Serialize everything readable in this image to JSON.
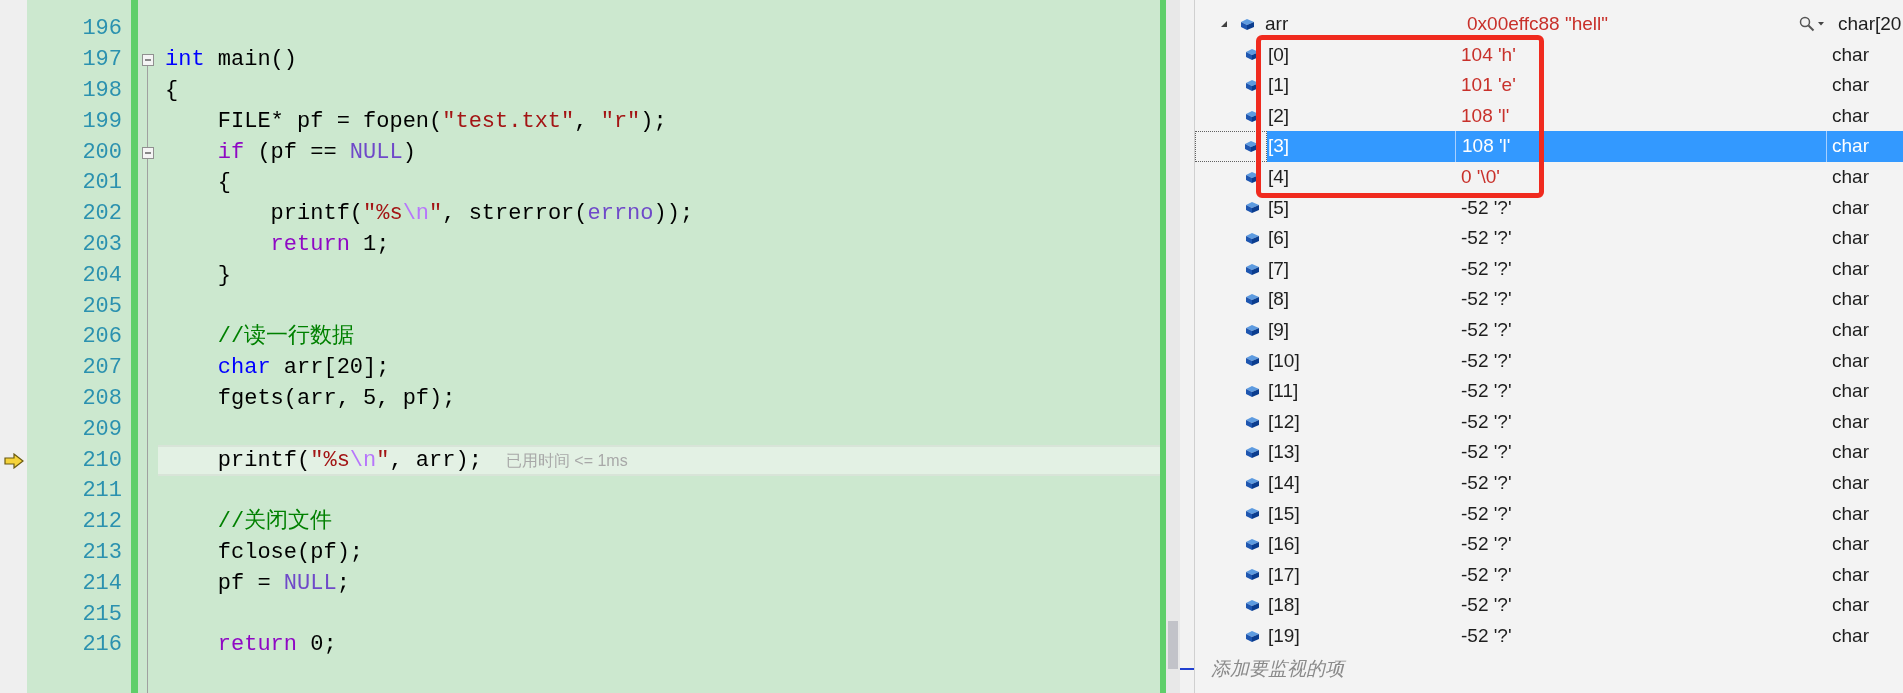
{
  "editor": {
    "lines": [
      {
        "number": "196",
        "collapsible": false,
        "current": false
      },
      {
        "number": "197",
        "collapsible": true,
        "current": false,
        "tokens": [
          {
            "kind": "keyword",
            "text": "int"
          },
          {
            "kind": "plain",
            "text": " main()"
          }
        ]
      },
      {
        "number": "198",
        "collapsible": false,
        "current": false,
        "tokens": [
          {
            "kind": "plain",
            "text": "{"
          }
        ]
      },
      {
        "number": "199",
        "collapsible": false,
        "current": false,
        "tokens": [
          {
            "kind": "plain",
            "text": "    FILE* pf = fopen("
          },
          {
            "kind": "string",
            "text": "\"test.txt\""
          },
          {
            "kind": "plain",
            "text": ", "
          },
          {
            "kind": "string",
            "text": "\"r\""
          },
          {
            "kind": "plain",
            "text": ");"
          }
        ]
      },
      {
        "number": "200",
        "collapsible": true,
        "current": false,
        "tokens": [
          {
            "kind": "control",
            "text": "    if"
          },
          {
            "kind": "plain",
            "text": " (pf == "
          },
          {
            "kind": "macro",
            "text": "NULL"
          },
          {
            "kind": "plain",
            "text": ")"
          }
        ]
      },
      {
        "number": "201",
        "collapsible": false,
        "current": false,
        "tokens": [
          {
            "kind": "plain",
            "text": "    {"
          }
        ]
      },
      {
        "number": "202",
        "collapsible": false,
        "current": false,
        "tokens": [
          {
            "kind": "plain",
            "text": "        printf("
          },
          {
            "kind": "string",
            "text": "\"%s"
          },
          {
            "kind": "escape",
            "text": "\\n"
          },
          {
            "kind": "string",
            "text": "\""
          },
          {
            "kind": "plain",
            "text": ", strerror("
          },
          {
            "kind": "macro",
            "text": "errno"
          },
          {
            "kind": "plain",
            "text": "));"
          }
        ]
      },
      {
        "number": "203",
        "collapsible": false,
        "current": false,
        "tokens": [
          {
            "kind": "control",
            "text": "        return"
          },
          {
            "kind": "plain",
            "text": " 1;"
          }
        ]
      },
      {
        "number": "204",
        "collapsible": false,
        "current": false,
        "tokens": [
          {
            "kind": "plain",
            "text": "    }"
          }
        ]
      },
      {
        "number": "205",
        "collapsible": false,
        "current": false
      },
      {
        "number": "206",
        "collapsible": false,
        "current": false,
        "tokens": [
          {
            "kind": "comment",
            "text": "    //读一行数据"
          }
        ]
      },
      {
        "number": "207",
        "collapsible": false,
        "current": false,
        "tokens": [
          {
            "kind": "keyword",
            "text": "    char"
          },
          {
            "kind": "plain",
            "text": " arr[20];"
          }
        ]
      },
      {
        "number": "208",
        "collapsible": false,
        "current": false,
        "tokens": [
          {
            "kind": "plain",
            "text": "    fgets(arr, 5, pf);"
          }
        ]
      },
      {
        "number": "209",
        "collapsible": false,
        "current": false
      },
      {
        "number": "210",
        "collapsible": false,
        "current": true,
        "hint": "已用时间 <= 1ms",
        "tokens": [
          {
            "kind": "plain",
            "text": "    printf("
          },
          {
            "kind": "string",
            "text": "\"%s"
          },
          {
            "kind": "escape",
            "text": "\\n"
          },
          {
            "kind": "string",
            "text": "\""
          },
          {
            "kind": "plain",
            "text": ", arr);"
          }
        ]
      },
      {
        "number": "211",
        "collapsible": false,
        "current": false
      },
      {
        "number": "212",
        "collapsible": false,
        "current": false,
        "tokens": [
          {
            "kind": "comment",
            "text": "    //关闭文件"
          }
        ]
      },
      {
        "number": "213",
        "collapsible": false,
        "current": false,
        "tokens": [
          {
            "kind": "plain",
            "text": "    fclose(pf);"
          }
        ]
      },
      {
        "number": "214",
        "collapsible": false,
        "current": false,
        "tokens": [
          {
            "kind": "plain",
            "text": "    pf = "
          },
          {
            "kind": "macro",
            "text": "NULL"
          },
          {
            "kind": "plain",
            "text": ";"
          }
        ]
      },
      {
        "number": "215",
        "collapsible": false,
        "current": false
      },
      {
        "number": "216",
        "collapsible": false,
        "current": false,
        "tokens": [
          {
            "kind": "control",
            "text": "    return"
          },
          {
            "kind": "plain",
            "text": " 0;"
          }
        ]
      }
    ]
  },
  "watch": {
    "root": {
      "name": "arr",
      "value": "0x00effc88 \"hell\"",
      "type": "char[20",
      "changed": true,
      "expanded": true,
      "selected": false,
      "children": [
        {
          "name": "[0]",
          "value": "104 'h'",
          "type": "char",
          "changed": true,
          "selected": false,
          "boxed": true
        },
        {
          "name": "[1]",
          "value": "101 'e'",
          "type": "char",
          "changed": true,
          "selected": false,
          "boxed": true
        },
        {
          "name": "[2]",
          "value": "108 'l'",
          "type": "char",
          "changed": true,
          "selected": false,
          "boxed": true
        },
        {
          "name": "[3]",
          "value": "108 'l'",
          "type": "char",
          "selected": true,
          "boxed": true
        },
        {
          "name": "[4]",
          "value": "0 '\\0'",
          "type": "char",
          "changed": true,
          "selected": false,
          "boxed": true
        },
        {
          "name": "[5]",
          "value": "-52 '?'",
          "type": "char",
          "changed": false,
          "selected": false,
          "boxed": false
        },
        {
          "name": "[6]",
          "value": "-52 '?'",
          "type": "char",
          "changed": false,
          "selected": false,
          "boxed": false
        },
        {
          "name": "[7]",
          "value": "-52 '?'",
          "type": "char",
          "changed": false,
          "selected": false,
          "boxed": false
        },
        {
          "name": "[8]",
          "value": "-52 '?'",
          "type": "char",
          "changed": false,
          "selected": false,
          "boxed": false
        },
        {
          "name": "[9]",
          "value": "-52 '?'",
          "type": "char",
          "changed": false,
          "selected": false,
          "boxed": false
        },
        {
          "name": "[10]",
          "value": "-52 '?'",
          "type": "char",
          "changed": false,
          "selected": false,
          "boxed": false
        },
        {
          "name": "[11]",
          "value": "-52 '?'",
          "type": "char",
          "changed": false,
          "selected": false,
          "boxed": false
        },
        {
          "name": "[12]",
          "value": "-52 '?'",
          "type": "char",
          "changed": false,
          "selected": false,
          "boxed": false
        },
        {
          "name": "[13]",
          "value": "-52 '?'",
          "type": "char",
          "changed": false,
          "selected": false,
          "boxed": false
        },
        {
          "name": "[14]",
          "value": "-52 '?'",
          "type": "char",
          "changed": false,
          "selected": false,
          "boxed": false
        },
        {
          "name": "[15]",
          "value": "-52 '?'",
          "type": "char",
          "changed": false,
          "selected": false,
          "boxed": false
        },
        {
          "name": "[16]",
          "value": "-52 '?'",
          "type": "char",
          "changed": false,
          "selected": false,
          "boxed": false
        },
        {
          "name": "[17]",
          "value": "-52 '?'",
          "type": "char",
          "changed": false,
          "selected": false,
          "boxed": false
        },
        {
          "name": "[18]",
          "value": "-52 '?'",
          "type": "char",
          "changed": false,
          "selected": false,
          "boxed": false
        },
        {
          "name": "[19]",
          "value": "-52 '?'",
          "type": "char",
          "changed": false,
          "selected": false,
          "boxed": false
        }
      ]
    },
    "add_item_placeholder": "添加要监视的项"
  }
}
